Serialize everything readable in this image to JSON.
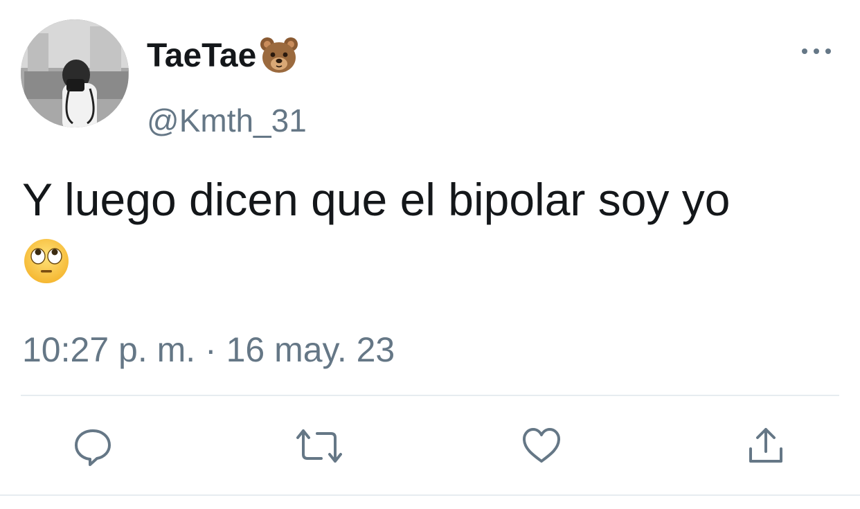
{
  "tweet": {
    "display_name": "TaeTae",
    "display_name_emoji": "bear-face-emoji",
    "handle": "@Kmth_31",
    "text": "Y luego dicen que el bipolar soy yo",
    "text_emoji": "face-with-rolling-eyes-emoji",
    "timestamp": "10:27 p. m. · 16 may. 23"
  },
  "icons": {
    "more": "more-options-icon",
    "reply": "reply-icon",
    "retweet": "retweet-icon",
    "like": "like-icon",
    "share": "share-icon"
  },
  "colors": {
    "text_primary": "#14171a",
    "text_secondary": "#657786",
    "divider": "#e6ecf0"
  }
}
